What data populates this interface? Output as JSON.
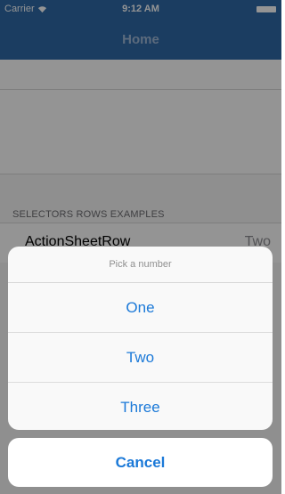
{
  "status_bar": {
    "carrier": "Carrier",
    "wifi_icon": "wifi-icon",
    "time": "9:12 AM",
    "battery_icon": "battery-icon"
  },
  "nav": {
    "title": "Home"
  },
  "section": {
    "header": "SELECTORS ROWS EXAMPLES"
  },
  "row": {
    "title": "ActionSheetRow",
    "value": "Two"
  },
  "action_sheet": {
    "title": "Pick a number",
    "options": [
      "One",
      "Two",
      "Three"
    ],
    "cancel": "Cancel"
  },
  "colors": {
    "nav_background": "#2f6aa8",
    "action_text": "#1b79d8"
  }
}
